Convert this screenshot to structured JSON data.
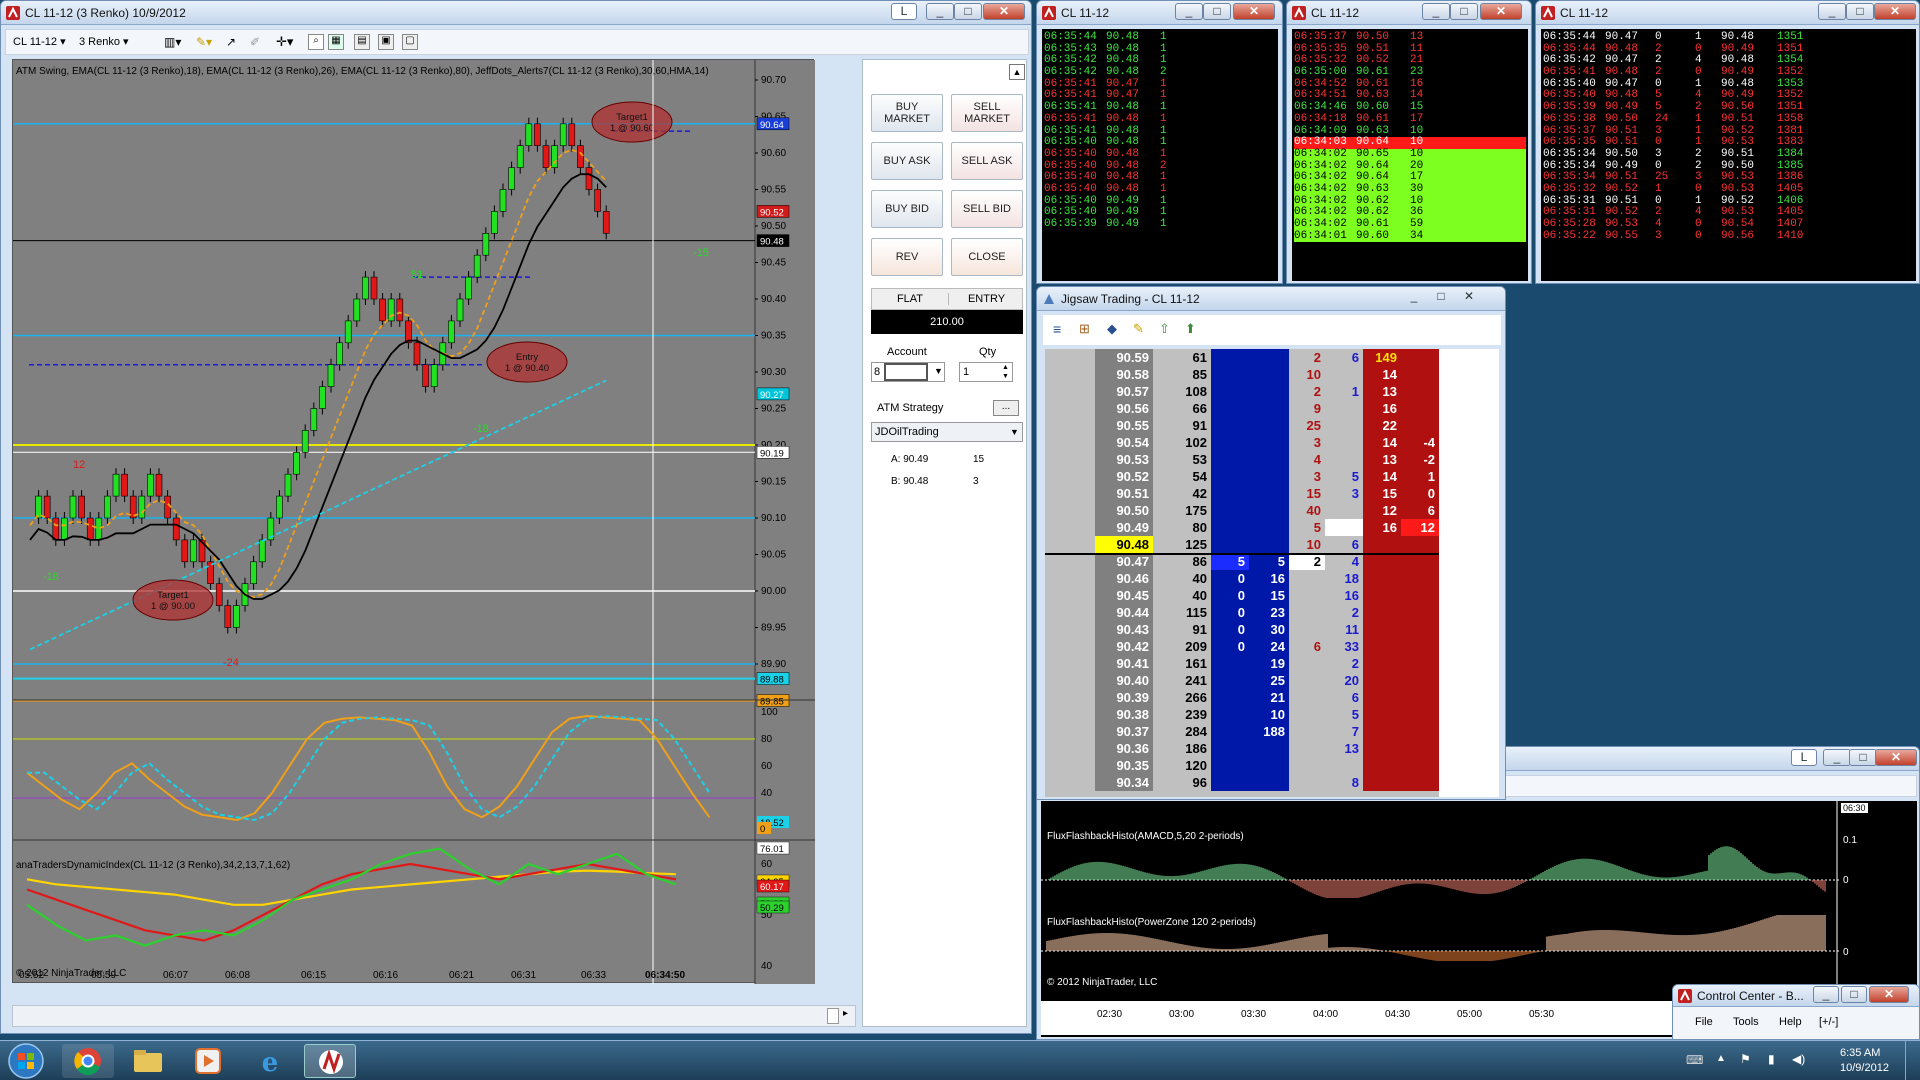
{
  "chart_window": {
    "title": "CL 11-12 (3 Renko)  10/9/2012",
    "instrument": "CL 11-12",
    "period": "3 Renko",
    "indicator_label": "ATM Swing, EMA(CL 11-12 (3 Renko),18), EMA(CL 11-12 (3 Renko),26), EMA(CL 11-12 (3 Renko),80), JeffDots_Alerts7(CL 11-12 (3 Renko),30,60,HMA,14)",
    "lower_label": "anaTradersDynamicIndex(CL 11-12 (3 Renko),34,2,13,7,1,62)",
    "copyright": "© 2012 NinjaTrader, LLC",
    "L": "L",
    "price_axis": [
      "90.70",
      "90.65",
      "90.60",
      "90.55",
      "90.50",
      "90.45",
      "90.40",
      "90.35",
      "90.30",
      "90.25",
      "90.20",
      "90.15",
      "90.10",
      "90.05",
      "90.00",
      "89.95",
      "89.90"
    ],
    "price_tags": [
      {
        "v": "90.64",
        "c": "#1a3fd8"
      },
      {
        "v": "90.52",
        "c": "#d11a1a"
      },
      {
        "v": "90.48",
        "c": "#000000"
      },
      {
        "v": "90.27",
        "c": "#00c4d8"
      },
      {
        "v": "90.19",
        "c": "#ffffff"
      },
      {
        "v": "89.88",
        "c": "#1ad1e8"
      },
      {
        "v": "89.85",
        "c": "#f0a018"
      }
    ],
    "osc_axis": [
      "100",
      "80",
      "60",
      "40",
      "20"
    ],
    "osc_tag": "18.52",
    "osc_tag2": "0",
    "tdi_axis": [
      "60",
      "50",
      "40"
    ],
    "tdi_tags": [
      {
        "v": "76.01",
        "c": "#ffffff"
      },
      {
        "v": "64.25",
        "c": "#ffd400"
      },
      {
        "v": "60.17",
        "c": "#e01818"
      },
      {
        "v": "52.39",
        "c": "#2dd12d"
      },
      {
        "v": "50.29",
        "c": "#2dd12d"
      }
    ],
    "time_axis": [
      "05:52",
      "05:59",
      "06:07",
      "06:08",
      "06:15",
      "06:16",
      "06:21",
      "06:31",
      "06:33",
      "06:34:50"
    ],
    "annotations": [
      {
        "t": "Target1\n1 @ 90.60"
      },
      {
        "t": "Entry\n1 @ 90.40"
      },
      {
        "t": "Target1\n1 @ 90.00"
      },
      {
        "t": "51"
      },
      {
        "t": "-18"
      },
      {
        "t": "-15"
      },
      {
        "t": "12"
      },
      {
        "t": "-18"
      },
      {
        "t": "-24"
      }
    ],
    "order_panel": {
      "buy_market": "BUY\nMARKET",
      "sell_market": "SELL\nMARKET",
      "buy_ask": "BUY ASK",
      "sell_ask": "SELL ASK",
      "buy_bid": "BUY BID",
      "sell_bid": "SELL BID",
      "rev": "REV",
      "close": "CLOSE",
      "flat": "FLAT",
      "entry": "ENTRY",
      "pnl": "210.00",
      "account_label": "Account",
      "account_value": "8",
      "qty_label": "Qty",
      "qty_value": "1",
      "atm_label": "ATM Strategy",
      "atm_value": "JDOilTrading",
      "a_label": "A: 90.49",
      "a_val": "15",
      "b_label": "B: 90.48",
      "b_val": "3"
    }
  },
  "ts1": {
    "title": "CL 11-12",
    "rows": [
      [
        "06:35:44",
        "90.48",
        "1",
        "g"
      ],
      [
        "06:35:43",
        "90.48",
        "1",
        "g"
      ],
      [
        "06:35:42",
        "90.48",
        "1",
        "g"
      ],
      [
        "06:35:42",
        "90.48",
        "2",
        "g"
      ],
      [
        "06:35:41",
        "90.47",
        "1",
        "r"
      ],
      [
        "06:35:41",
        "90.47",
        "1",
        "r"
      ],
      [
        "06:35:41",
        "90.48",
        "1",
        "g"
      ],
      [
        "06:35:41",
        "90.48",
        "1",
        "r"
      ],
      [
        "06:35:41",
        "90.48",
        "1",
        "g"
      ],
      [
        "06:35:40",
        "90.48",
        "1",
        "g"
      ],
      [
        "06:35:40",
        "90.48",
        "1",
        "r"
      ],
      [
        "06:35:40",
        "90.48",
        "2",
        "r"
      ],
      [
        "06:35:40",
        "90.48",
        "1",
        "r"
      ],
      [
        "06:35:40",
        "90.48",
        "1",
        "r"
      ],
      [
        "06:35:40",
        "90.49",
        "1",
        "g"
      ],
      [
        "06:35:40",
        "90.49",
        "1",
        "g"
      ],
      [
        "06:35:39",
        "90.49",
        "1",
        "g"
      ]
    ]
  },
  "ts2": {
    "title": "CL 11-12",
    "rows": [
      [
        "06:35:37",
        "90.50",
        "13",
        "r"
      ],
      [
        "06:35:35",
        "90.51",
        "11",
        "r"
      ],
      [
        "06:35:32",
        "90.52",
        "21",
        "r"
      ],
      [
        "06:35:00",
        "90.61",
        "23",
        "g"
      ],
      [
        "06:34:52",
        "90.61",
        "16",
        "r"
      ],
      [
        "06:34:51",
        "90.63",
        "14",
        "r"
      ],
      [
        "06:34:46",
        "90.60",
        "15",
        "g"
      ],
      [
        "06:34:18",
        "90.61",
        "17",
        "r"
      ],
      [
        "06:34:09",
        "90.63",
        "10",
        "g"
      ],
      [
        "06:34:03",
        "90.64",
        "10",
        "x"
      ],
      [
        "06:34:02",
        "90.65",
        "10",
        "L"
      ],
      [
        "06:34:02",
        "90.64",
        "20",
        "L"
      ],
      [
        "06:34:02",
        "90.64",
        "17",
        "L"
      ],
      [
        "06:34:02",
        "90.63",
        "30",
        "L"
      ],
      [
        "06:34:02",
        "90.62",
        "10",
        "L"
      ],
      [
        "06:34:02",
        "90.62",
        "36",
        "L"
      ],
      [
        "06:34:02",
        "90.61",
        "59",
        "L"
      ],
      [
        "06:34:01",
        "90.60",
        "34",
        "L"
      ]
    ]
  },
  "ts3": {
    "title": "CL 11-12",
    "rows": [
      [
        "06:35:44",
        "90.47",
        "0",
        "1",
        "90.48",
        "1351"
      ],
      [
        "06:35:44",
        "90.48",
        "2",
        "0",
        "90.49",
        "1351"
      ],
      [
        "06:35:42",
        "90.47",
        "2",
        "4",
        "90.48",
        "1354"
      ],
      [
        "06:35:41",
        "90.48",
        "2",
        "0",
        "90.49",
        "1352"
      ],
      [
        "06:35:40",
        "90.47",
        "0",
        "1",
        "90.48",
        "1353"
      ],
      [
        "06:35:40",
        "90.48",
        "5",
        "4",
        "90.49",
        "1352"
      ],
      [
        "06:35:39",
        "90.49",
        "5",
        "2",
        "90.50",
        "1351"
      ],
      [
        "06:35:38",
        "90.50",
        "24",
        "1",
        "90.51",
        "1358"
      ],
      [
        "06:35:37",
        "90.51",
        "3",
        "1",
        "90.52",
        "1381"
      ],
      [
        "06:35:35",
        "90.51",
        "0",
        "1",
        "90.53",
        "1383"
      ],
      [
        "06:35:34",
        "90.50",
        "3",
        "2",
        "90.51",
        "1384"
      ],
      [
        "06:35:34",
        "90.49",
        "0",
        "2",
        "90.50",
        "1385"
      ],
      [
        "06:35:34",
        "90.51",
        "25",
        "3",
        "90.53",
        "1386"
      ],
      [
        "06:35:32",
        "90.52",
        "1",
        "0",
        "90.53",
        "1405"
      ],
      [
        "06:35:31",
        "90.51",
        "0",
        "1",
        "90.52",
        "1406"
      ],
      [
        "06:35:31",
        "90.52",
        "2",
        "4",
        "90.53",
        "1405"
      ],
      [
        "06:35:28",
        "90.53",
        "4",
        "0",
        "90.54",
        "1407"
      ],
      [
        "06:35:22",
        "90.55",
        "3",
        "0",
        "90.56",
        "1410"
      ]
    ],
    "colors": [
      "g",
      "r",
      "g",
      "r",
      "g",
      "r",
      "r",
      "r",
      "r",
      "r",
      "g",
      "g",
      "r",
      "r",
      "g",
      "r",
      "r",
      "r"
    ]
  },
  "ladder": {
    "title": "Jigsaw Trading - CL 11-12",
    "rows": [
      [
        "90.59",
        "61",
        "",
        "",
        "2",
        "6",
        "149",
        "",
        ""
      ],
      [
        "90.58",
        "85",
        "",
        "",
        "10",
        "",
        "14",
        "",
        ""
      ],
      [
        "90.57",
        "108",
        "",
        "",
        "2",
        "1",
        "13",
        "",
        ""
      ],
      [
        "90.56",
        "66",
        "",
        "",
        "9",
        "",
        "16",
        "",
        ""
      ],
      [
        "90.55",
        "91",
        "",
        "",
        "25",
        "",
        "22",
        "",
        ""
      ],
      [
        "90.54",
        "102",
        "",
        "",
        "3",
        "",
        "14",
        "-4",
        ""
      ],
      [
        "90.53",
        "53",
        "",
        "",
        "4",
        "",
        "13",
        "-2",
        ""
      ],
      [
        "90.52",
        "54",
        "",
        "",
        "3",
        "5",
        "14",
        "1",
        ""
      ],
      [
        "90.51",
        "42",
        "",
        "",
        "15",
        "3",
        "15",
        "0",
        ""
      ],
      [
        "90.50",
        "175",
        "",
        "",
        "40",
        "",
        "12",
        "6",
        ""
      ],
      [
        "90.49",
        "80",
        "",
        "",
        "5",
        "",
        "16",
        "12",
        ""
      ],
      [
        "90.48",
        "125",
        "",
        "",
        "10",
        "6",
        "",
        "",
        ""
      ],
      [
        "90.47",
        "86",
        "5",
        "5",
        "2",
        "4",
        "",
        "",
        ""
      ],
      [
        "90.46",
        "40",
        "0",
        "16",
        "",
        "18",
        "",
        "",
        ""
      ],
      [
        "90.45",
        "40",
        "0",
        "15",
        "",
        "16",
        "",
        "",
        ""
      ],
      [
        "90.44",
        "115",
        "0",
        "23",
        "",
        "2",
        "",
        "",
        ""
      ],
      [
        "90.43",
        "91",
        "0",
        "30",
        "",
        "11",
        "",
        "",
        ""
      ],
      [
        "90.42",
        "209",
        "0",
        "24",
        "6",
        "33",
        "",
        "",
        ""
      ],
      [
        "90.41",
        "161",
        "",
        "19",
        "",
        "2",
        "",
        "",
        ""
      ],
      [
        "90.40",
        "241",
        "",
        "25",
        "",
        "20",
        "",
        "",
        ""
      ],
      [
        "90.39",
        "266",
        "",
        "21",
        "",
        "6",
        "",
        "",
        ""
      ],
      [
        "90.38",
        "239",
        "",
        "10",
        "",
        "5",
        "",
        "",
        ""
      ],
      [
        "90.37",
        "284",
        "",
        "188",
        "",
        "7",
        "",
        "",
        ""
      ],
      [
        "90.36",
        "186",
        "",
        "",
        "",
        "13",
        "",
        "",
        ""
      ],
      [
        "90.35",
        "120",
        "",
        "",
        "",
        "",
        "",
        "",
        ""
      ],
      [
        "90.34",
        "96",
        "",
        "",
        "",
        "8",
        "",
        "",
        ""
      ]
    ]
  },
  "flux": {
    "label1": "FluxFlashbackHisto(AMACD,5,20 2-periods)",
    "label2": "FluxFlashbackHisto(PowerZone 120 2-periods)",
    "copyright": "© 2012 NinjaTrader, LLC",
    "axis1": [
      "0.1",
      "0"
    ],
    "axis2": [
      "0"
    ],
    "time_tag": "06:30",
    "times": [
      "02:30",
      "03:00",
      "03:30",
      "04:00",
      "04:30",
      "05:00",
      "05:30"
    ],
    "L": "L"
  },
  "control_center": {
    "title": "Control Center - B...",
    "menu": [
      "File",
      "Tools",
      "Help",
      "[+/-]"
    ]
  },
  "taskbar": {
    "time": "6:35 AM",
    "date": "10/9/2012"
  }
}
